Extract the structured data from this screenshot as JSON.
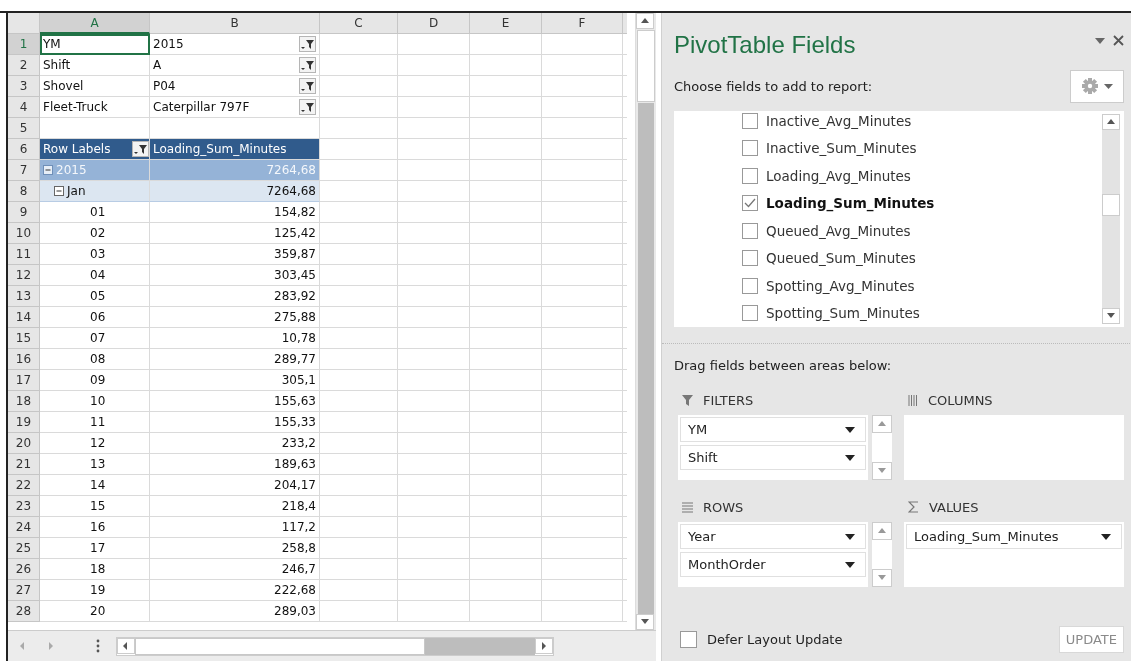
{
  "sheet": {
    "columns": [
      {
        "label": "A",
        "selected": true
      },
      {
        "label": "B",
        "selected": false
      },
      {
        "label": "C",
        "selected": false
      },
      {
        "label": "D",
        "selected": false
      },
      {
        "label": "E",
        "selected": false
      },
      {
        "label": "F",
        "selected": false
      }
    ],
    "rows": [
      {
        "number": "1",
        "kind": "filter",
        "label": "YM",
        "value": "2015",
        "selected": true
      },
      {
        "number": "2",
        "kind": "filter",
        "label": "Shift",
        "value": "A",
        "selected": false
      },
      {
        "number": "3",
        "kind": "filter",
        "label": "Shovel",
        "value": "P04",
        "selected": false
      },
      {
        "number": "4",
        "kind": "filter",
        "label": "Fleet-Truck",
        "value": "Caterpillar 797F",
        "selected": false
      },
      {
        "number": "5",
        "kind": "blank",
        "selected": false
      },
      {
        "number": "6",
        "kind": "header",
        "label": "Row Labels",
        "value": "Loading_Sum_Minutes",
        "selected": false
      },
      {
        "number": "7",
        "kind": "year",
        "label": "2015",
        "value": "7264,68",
        "expanded": true,
        "selected": false
      },
      {
        "number": "8",
        "kind": "month",
        "label": "Jan",
        "value": "7264,68",
        "expanded": true,
        "selected": false
      },
      {
        "number": "9",
        "kind": "day",
        "label": "01",
        "value": "154,82",
        "selected": false
      },
      {
        "number": "10",
        "kind": "day",
        "label": "02",
        "value": "125,42",
        "selected": false
      },
      {
        "number": "11",
        "kind": "day",
        "label": "03",
        "value": "359,87",
        "selected": false
      },
      {
        "number": "12",
        "kind": "day",
        "label": "04",
        "value": "303,45",
        "selected": false
      },
      {
        "number": "13",
        "kind": "day",
        "label": "05",
        "value": "283,92",
        "selected": false
      },
      {
        "number": "14",
        "kind": "day",
        "label": "06",
        "value": "275,88",
        "selected": false
      },
      {
        "number": "15",
        "kind": "day",
        "label": "07",
        "value": "10,78",
        "selected": false
      },
      {
        "number": "16",
        "kind": "day",
        "label": "08",
        "value": "289,77",
        "selected": false
      },
      {
        "number": "17",
        "kind": "day",
        "label": "09",
        "value": "305,1",
        "selected": false
      },
      {
        "number": "18",
        "kind": "day",
        "label": "10",
        "value": "155,63",
        "selected": false
      },
      {
        "number": "19",
        "kind": "day",
        "label": "11",
        "value": "155,33",
        "selected": false
      },
      {
        "number": "20",
        "kind": "day",
        "label": "12",
        "value": "233,2",
        "selected": false
      },
      {
        "number": "21",
        "kind": "day",
        "label": "13",
        "value": "189,63",
        "selected": false
      },
      {
        "number": "22",
        "kind": "day",
        "label": "14",
        "value": "204,17",
        "selected": false
      },
      {
        "number": "23",
        "kind": "day",
        "label": "15",
        "value": "218,4",
        "selected": false
      },
      {
        "number": "24",
        "kind": "day",
        "label": "16",
        "value": "117,2",
        "selected": false
      },
      {
        "number": "25",
        "kind": "day",
        "label": "17",
        "value": "258,8",
        "selected": false
      },
      {
        "number": "26",
        "kind": "day",
        "label": "18",
        "value": "246,7",
        "selected": false
      },
      {
        "number": "27",
        "kind": "day",
        "label": "19",
        "value": "222,68",
        "selected": false
      },
      {
        "number": "28",
        "kind": "day",
        "label": "20",
        "value": "289,03",
        "selected": false
      }
    ]
  },
  "pane": {
    "title": "PivotTable Fields",
    "subtitle": "Choose fields to add to report:",
    "fields": [
      {
        "label": "Inactive_Avg_Minutes",
        "checked": false
      },
      {
        "label": "Inactive_Sum_Minutes",
        "checked": false
      },
      {
        "label": "Loading_Avg_Minutes",
        "checked": false
      },
      {
        "label": "Loading_Sum_Minutes",
        "checked": true
      },
      {
        "label": "Queued_Avg_Minutes",
        "checked": false
      },
      {
        "label": "Queued_Sum_Minutes",
        "checked": false
      },
      {
        "label": "Spotting_Avg_Minutes",
        "checked": false
      },
      {
        "label": "Spotting_Sum_Minutes",
        "checked": false
      }
    ],
    "areas_hint": "Drag fields between areas below:",
    "areas": [
      {
        "kind": "filters",
        "label": "FILTERS",
        "items": [
          "YM",
          "Shift"
        ],
        "scrollable": true
      },
      {
        "kind": "columns",
        "label": "COLUMNS",
        "scrollable": false
      },
      {
        "kind": "rows",
        "label": "ROWS",
        "items": [
          "Year",
          "MonthOrder"
        ],
        "scrollable": true
      },
      {
        "kind": "values",
        "label": "VALUES",
        "items": [
          "Loading_Sum_Minutes"
        ],
        "scrollable": false
      }
    ],
    "defer": {
      "label": "Defer Layout Update",
      "checked": false
    },
    "update": {
      "label": "UPDATE",
      "disabled": true
    }
  }
}
